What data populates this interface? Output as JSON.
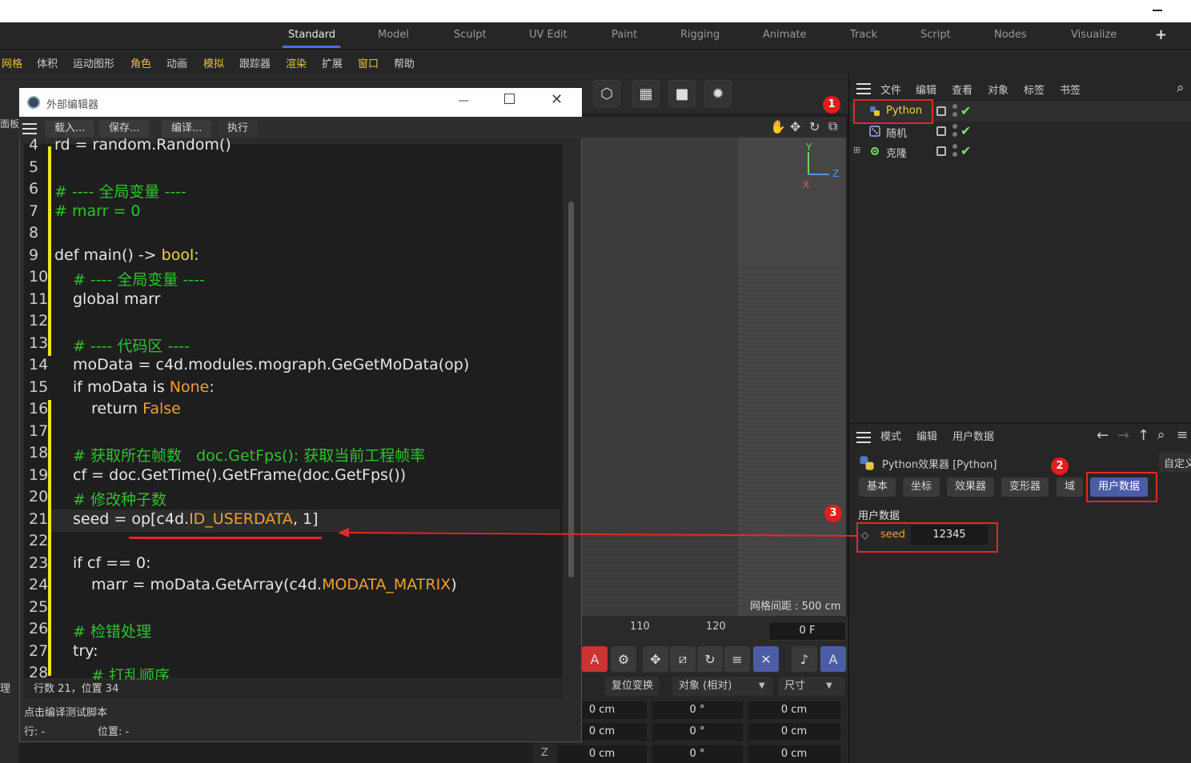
{
  "layout_tabs": [
    "Standard",
    "Model",
    "Sculpt",
    "UV Edit",
    "Paint",
    "Rigging",
    "Animate",
    "Track",
    "Script",
    "Nodes",
    "Visualize"
  ],
  "menu": [
    "网格",
    "体积",
    "运动图形",
    "角色",
    "动画",
    "模拟",
    "跟踪器",
    "渲染",
    "扩展",
    "窗口",
    "帮助"
  ],
  "left_label": "面板",
  "left_label2": "理",
  "editor": {
    "title": "外部编辑器",
    "buttons": [
      "载入...",
      "保存...",
      "编译...",
      "执行"
    ],
    "status_pos": "行数 21，位置 34",
    "status_hint": "点击编译测试脚本",
    "status_line": "行: -",
    "status_col": "位置: -",
    "code": [
      {
        "n": "4",
        "t": "rd = random.Random()"
      },
      {
        "n": "5",
        "t": ""
      },
      {
        "n": "6",
        "t": "# ---- 全局变量 ----"
      },
      {
        "n": "7",
        "t": "# marr = 0"
      },
      {
        "n": "8",
        "t": ""
      },
      {
        "n": "9",
        "t": "def main() -> bool:"
      },
      {
        "n": "10",
        "t": "# ---- 全局变量 ----"
      },
      {
        "n": "11",
        "t": "global marr"
      },
      {
        "n": "12",
        "t": ""
      },
      {
        "n": "13",
        "t": "# ---- 代码区 ----"
      },
      {
        "n": "14",
        "t": "moData = c4d.modules.mograph.GeGetMoData(op)"
      },
      {
        "n": "15",
        "t": "if moData is None:"
      },
      {
        "n": "16",
        "t": "return False"
      },
      {
        "n": "17",
        "t": ""
      },
      {
        "n": "18",
        "t": "# 获取所在帧数   doc.GetFps(): 获取当前工程帧率"
      },
      {
        "n": "19",
        "t": "cf = doc.GetTime().GetFrame(doc.GetFps())"
      },
      {
        "n": "20",
        "t": "# 修改种子数"
      },
      {
        "n": "21",
        "t": "seed = op[c4d.ID_USERDATA, 1]"
      },
      {
        "n": "22",
        "t": ""
      },
      {
        "n": "23",
        "t": "if cf == 0:"
      },
      {
        "n": "24",
        "t": "marr = moData.GetArray(c4d.MODATA_MATRIX)"
      },
      {
        "n": "25",
        "t": ""
      },
      {
        "n": "26",
        "t": "# 检错处理"
      },
      {
        "n": "27",
        "t": "try:"
      },
      {
        "n": "28",
        "t": "# 打乱顺序"
      }
    ]
  },
  "viewport": {
    "grid_label": "网格间距 : 500 cm",
    "axis_y": "Y",
    "axis_z": "Z",
    "axis_x": "X"
  },
  "timeline": {
    "tick_110": "110",
    "tick_120": "120",
    "frame": "0 F"
  },
  "coords": {
    "reset": "复位变换",
    "mode": "对象 (相对)",
    "size": "尺寸",
    "row_label_z": "Z",
    "rows": [
      [
        "0 cm",
        "0 °",
        "0 cm"
      ],
      [
        "0 cm",
        "0 °",
        "0 cm"
      ],
      [
        "0 cm",
        "0 °",
        "0 cm"
      ]
    ]
  },
  "object_manager": {
    "menu": [
      "文件",
      "编辑",
      "查看",
      "对象",
      "标签",
      "书签"
    ],
    "items": [
      {
        "name": "Python",
        "color": "#f2d63c"
      },
      {
        "name": "随机",
        "color": "#cfcfcf"
      },
      {
        "name": "克隆",
        "color": "#cfcfcf"
      }
    ]
  },
  "attributes": {
    "menu": [
      "模式",
      "编辑",
      "用户数据"
    ],
    "object_title": "Python效果器 [Python]",
    "custom": "自定义",
    "tabs": [
      "基本",
      "坐标",
      "效果器",
      "变形器",
      "域",
      "用户数据"
    ],
    "section": "用户数据",
    "field_name": "seed",
    "field_value": "12345"
  },
  "annotations": [
    "1",
    "2",
    "3"
  ],
  "colors": {
    "accent": "#4a6fd8",
    "annotation_red": "#e02a2a",
    "comment_green": "#2fc22f",
    "keyword_orange": "#f0a030",
    "change_bar_yellow": "#f2e320"
  }
}
